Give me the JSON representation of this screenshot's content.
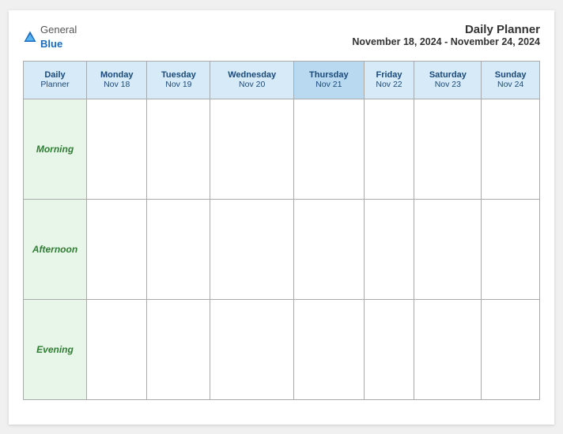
{
  "logo": {
    "general": "General",
    "blue": "Blue"
  },
  "header": {
    "title": "Daily Planner",
    "date_range": "November 18, 2024 - November 24, 2024"
  },
  "table": {
    "columns": [
      {
        "day": "Daily\nPlanner",
        "date": ""
      },
      {
        "day": "Monday",
        "date": "Nov 18"
      },
      {
        "day": "Tuesday",
        "date": "Nov 19"
      },
      {
        "day": "Wednesday",
        "date": "Nov 20"
      },
      {
        "day": "Thursday",
        "date": "Nov 21"
      },
      {
        "day": "Friday",
        "date": "Nov 22"
      },
      {
        "day": "Saturday",
        "date": "Nov 23"
      },
      {
        "day": "Sunday",
        "date": "Nov 24"
      }
    ],
    "rows": [
      {
        "label": "Morning"
      },
      {
        "label": "Afternoon"
      },
      {
        "label": "Evening"
      }
    ]
  }
}
